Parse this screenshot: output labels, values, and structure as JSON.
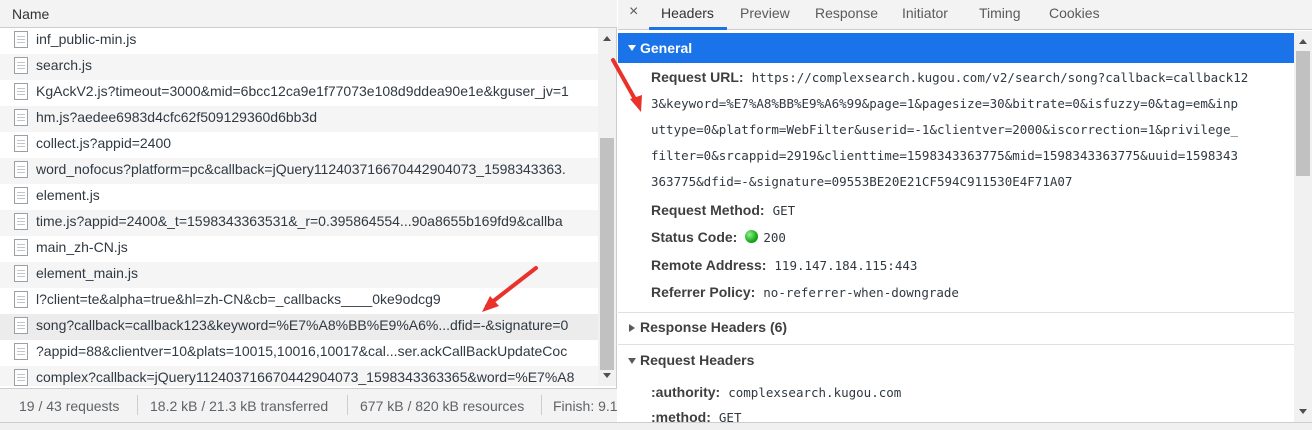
{
  "network_list": {
    "column_header": "Name",
    "requests": [
      {
        "name": "inf_public-min.js"
      },
      {
        "name": "search.js"
      },
      {
        "name": "KgAckV2.js?timeout=3000&mid=6bcc12ca9e1f77073e108d9ddea90e1e&kguser_jv=1"
      },
      {
        "name": "hm.js?aedee6983d4cfc62f509129360d6bb3d"
      },
      {
        "name": "collect.js?appid=2400"
      },
      {
        "name": "word_nofocus?platform=pc&callback=jQuery112403716670442904073_1598343363."
      },
      {
        "name": "element.js"
      },
      {
        "name": "time.js?appid=2400&_t=1598343363531&_r=0.395864554...90a8655b169fd9&callba"
      },
      {
        "name": "main_zh-CN.js"
      },
      {
        "name": "element_main.js"
      },
      {
        "name": "l?client=te&alpha=true&hl=zh-CN&cb=_callbacks____0ke9odcg9"
      },
      {
        "name": "song?callback=callback123&keyword=%E7%A8%BB%E9%A6%...dfid=-&signature=0"
      },
      {
        "name": "?appid=88&clientver=10&plats=10015,10016,10017&cal...ser.ackCallBackUpdateCoc"
      },
      {
        "name": "complex?callback=jQuery112403716670442904073_1598343363365&word=%E7%A8"
      }
    ],
    "selected_index": 11
  },
  "status_bar": {
    "requests": "19 / 43 requests",
    "transferred": "18.2 kB / 21.3 kB transferred",
    "resources": "677 kB / 820 kB resources",
    "finish": "Finish: 9.1"
  },
  "detail_tabs": {
    "close_symbol": "×",
    "tabs": [
      "Headers",
      "Preview",
      "Response",
      "Initiator",
      "Timing",
      "Cookies"
    ],
    "active": "Headers"
  },
  "general": {
    "section_title": "General",
    "request_url_label": "Request URL:",
    "request_url_lines": [
      "https://complexsearch.kugou.com/v2/search/song?callback=callback12",
      "3&keyword=%E7%A8%BB%E9%A6%99&page=1&pagesize=30&bitrate=0&isfuzzy=0&tag=em&inp",
      "uttype=0&platform=WebFilter&userid=-1&clientver=2000&iscorrection=1&privilege_",
      "filter=0&srcappid=2919&clienttime=1598343363775&mid=1598343363775&uuid=1598343",
      "363775&dfid=-&signature=09553BE20E21CF594C911530E4F71A07"
    ],
    "request_method_label": "Request Method:",
    "request_method": "GET",
    "status_code_label": "Status Code:",
    "status_code": "200",
    "remote_address_label": "Remote Address:",
    "remote_address": "119.147.184.115:443",
    "referrer_policy_label": "Referrer Policy:",
    "referrer_policy": "no-referrer-when-downgrade"
  },
  "response_headers": {
    "title": "Response Headers (6)"
  },
  "request_headers": {
    "title": "Request Headers",
    "authority_label": ":authority:",
    "authority": "complexsearch.kugou.com",
    "method_label": ":method:",
    "method": "GET"
  },
  "colors": {
    "accent": "#1a73e8",
    "annotation_arrow": "#e8322a",
    "status_ok": "#16a916"
  }
}
